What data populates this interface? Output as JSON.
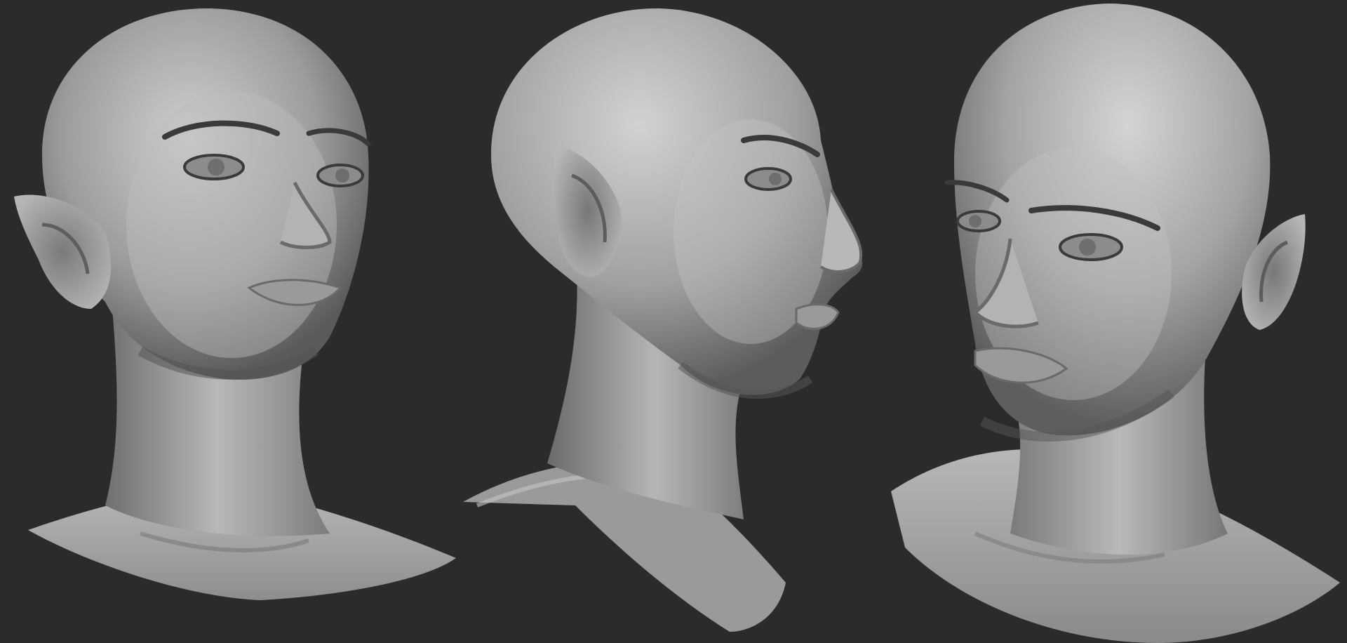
{
  "scene": {
    "background_color": "#2b2b2b",
    "subject": "elf-head-sculpt",
    "views": [
      {
        "id": "three-quarter-left"
      },
      {
        "id": "right-profile"
      },
      {
        "id": "three-quarter-right-low"
      }
    ]
  }
}
